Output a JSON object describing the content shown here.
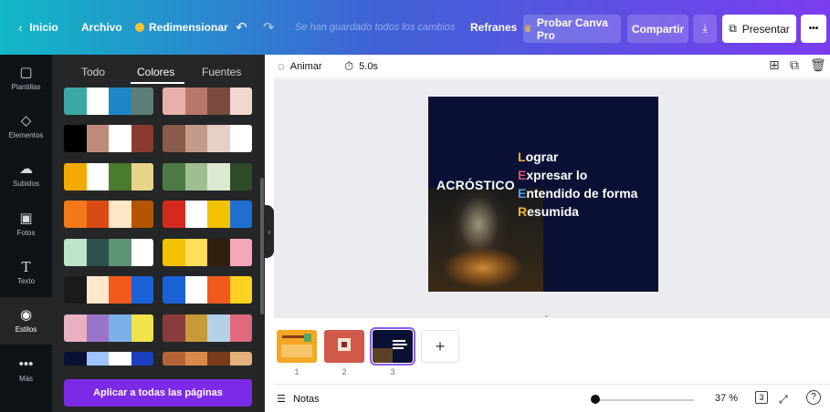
{
  "topbar": {
    "back_label": "Inicio",
    "file_label": "Archivo",
    "resize_label": "Redimensionar",
    "undo_icon": "undo-icon",
    "redo_icon": "redo-icon",
    "saved_status": "Se han guardado todos los cambios",
    "project_name": "Refranes",
    "pro_label": "Probar Canva Pro",
    "share_label": "Compartir",
    "present_label": "Presentar",
    "more_label": "•••"
  },
  "rail": {
    "items": [
      {
        "label": "Plantillas",
        "icon": "templates-icon"
      },
      {
        "label": "Elementos",
        "icon": "elements-icon"
      },
      {
        "label": "Subidos",
        "icon": "upload-icon"
      },
      {
        "label": "Fotos",
        "icon": "photos-icon"
      },
      {
        "label": "Texto",
        "icon": "text-icon"
      },
      {
        "label": "Estilos",
        "icon": "styles-icon"
      },
      {
        "label": "Más",
        "icon": "more-icon"
      }
    ]
  },
  "panel": {
    "tabs": [
      "Todo",
      "Colores",
      "Fuentes"
    ],
    "active_tab": "Colores",
    "apply_label": "Aplicar a todas las páginas",
    "palettes": [
      [
        [
          "#3aa8a4",
          "#ffffff",
          "#1e88c7",
          "#5e7d78"
        ],
        [
          "#e8b0a8",
          "#b9776b",
          "#7a4a3f",
          "#f2d7cf"
        ]
      ],
      [
        [
          "#000000",
          "#c08a7a",
          "#ffffff",
          "#8a3b2e"
        ],
        [
          "#8a5a4a",
          "#c49a8a",
          "#e6cfc4",
          "#ffffff"
        ]
      ],
      [
        [
          "#f2a900",
          "#ffffff",
          "#4b7b2c",
          "#e9d38a"
        ],
        [
          "#4e7a46",
          "#9fbf93",
          "#dce9d2",
          "#2e4b2a"
        ]
      ],
      [
        [
          "#f27a1a",
          "#d94b12",
          "#fbe7c6",
          "#b35400"
        ],
        [
          "#d42a1e",
          "#ffffff",
          "#f2c200",
          "#1f6fd1"
        ]
      ],
      [
        [
          "#bfe3c8",
          "#2f4f4f",
          "#5d9473",
          "#ffffff"
        ],
        [
          "#f2c200",
          "#ffde59",
          "#2e1f0f",
          "#f7a8b8"
        ]
      ],
      [
        [
          "#1a1a1a",
          "#ffe7cc",
          "#f25a1d",
          "#1b62d6"
        ],
        [
          "#1b62d6",
          "#ffffff",
          "#f25a1d",
          "#ffd21f"
        ]
      ],
      [
        [
          "#e8b0c0",
          "#9a74c8",
          "#7cb0e8",
          "#f2e34a"
        ],
        [
          "#8a3b3b",
          "#c79a3a",
          "#b5d1e8",
          "#e06a7c"
        ]
      ],
      [
        [
          "#0a1135",
          "#9ec4ff",
          "#ffffff",
          "#1b3fbf"
        ],
        [
          "#b8643a",
          "#d98a4a",
          "#7a3b1a",
          "#e2b27a"
        ]
      ]
    ]
  },
  "editor_toolbar": {
    "animate_label": "Animar",
    "duration_label": "5.0s"
  },
  "slide": {
    "title": "ACRÓSTICO",
    "lines": [
      {
        "first": "L",
        "rest": "ograr"
      },
      {
        "first": "E",
        "rest": "xpresar lo"
      },
      {
        "first": "E",
        "rest": "ntendido de forma"
      },
      {
        "first": "R",
        "rest": "esumida"
      }
    ]
  },
  "pages": {
    "items": [
      {
        "number": "1",
        "bg": "#f5a623"
      },
      {
        "number": "2",
        "bg": "#d0594a"
      },
      {
        "number": "3",
        "bg": "#0a1135"
      }
    ],
    "add_label": "+"
  },
  "bottombar": {
    "notes_label": "Notas",
    "zoom_label": "37 %",
    "zoom_fraction": 0.37,
    "page_count": "3",
    "help_label": "?"
  }
}
